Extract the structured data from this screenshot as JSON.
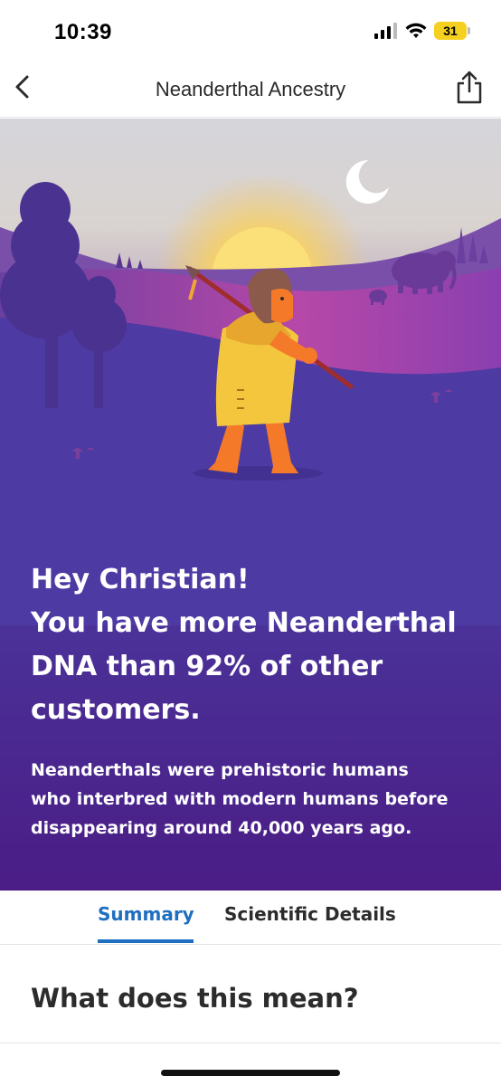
{
  "status_bar": {
    "time": "10:39",
    "battery": "31",
    "icons": [
      "signal-icon",
      "wifi-icon",
      "battery-icon"
    ]
  },
  "nav": {
    "title": "Neanderthal Ancestry",
    "back_icon": "chevron-left-icon",
    "share_icon": "share-icon"
  },
  "hero": {
    "heading_lines": [
      "Hey Christian!",
      "You have more Neanderthal",
      "DNA than 92% of other",
      "customers."
    ],
    "body_lines": [
      "Neanderthals were prehistoric humans",
      "who interbred with modern humans before",
      "disappearing around 40,000 years ago."
    ]
  },
  "tabs": [
    {
      "label": "Summary",
      "active": true
    },
    {
      "label": "Scientific Details",
      "active": false
    }
  ],
  "section": {
    "title": "What does this mean?"
  },
  "colors": {
    "accent": "#1e6fc0",
    "hero_purple": "#4a2f96"
  }
}
